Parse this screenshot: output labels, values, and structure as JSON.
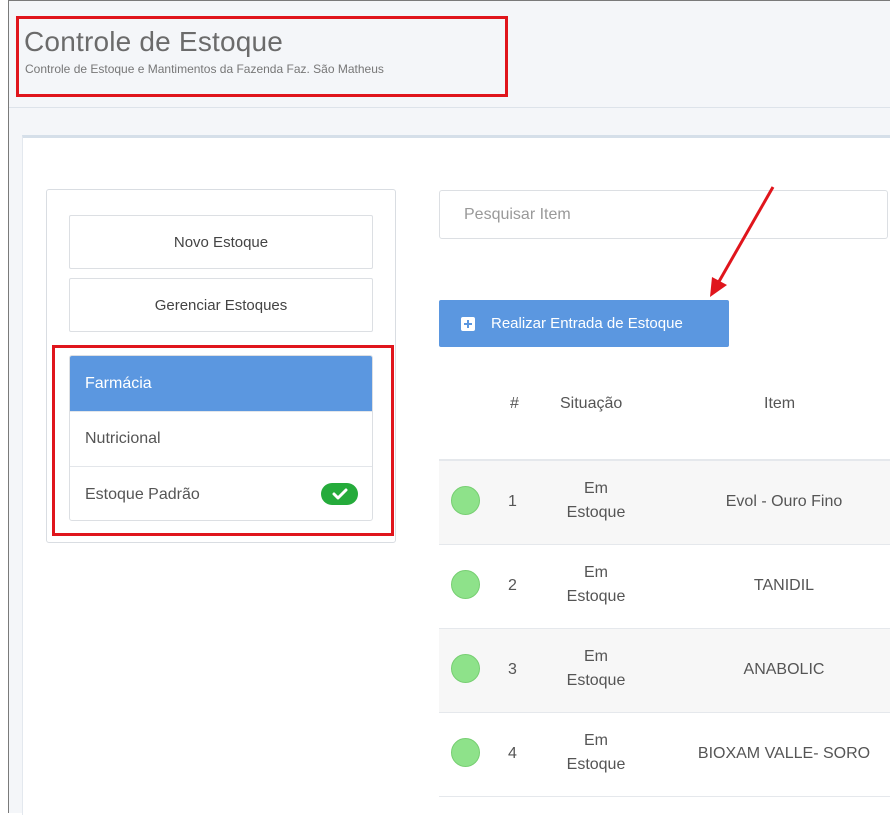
{
  "header": {
    "title": "Controle de Estoque",
    "subtitle": "Controle de Estoque e Mantimentos da Fazenda Faz. São Matheus"
  },
  "sidebar": {
    "new_stock_label": "Novo Estoque",
    "manage_stocks_label": "Gerenciar Estoques",
    "stocks": [
      {
        "label": "Farmácia",
        "active": true
      },
      {
        "label": "Nutricional",
        "active": false
      },
      {
        "label": "Estoque Padrão",
        "active": false,
        "default": true
      }
    ]
  },
  "search": {
    "placeholder": "Pesquisar Item",
    "value": ""
  },
  "actions": {
    "entry_label": "Realizar Entrada de Estoque"
  },
  "table": {
    "headers": [
      "#",
      "Situação",
      "Item"
    ],
    "rows": [
      {
        "num": "1",
        "situacao_line1": "Em",
        "situacao_line2": "Estoque",
        "item": "Evol - Ouro Fino"
      },
      {
        "num": "2",
        "situacao_line1": "Em",
        "situacao_line2": "Estoque",
        "item": "TANIDIL"
      },
      {
        "num": "3",
        "situacao_line1": "Em",
        "situacao_line2": "Estoque",
        "item": "ANABOLIC"
      },
      {
        "num": "4",
        "situacao_line1": "Em",
        "situacao_line2": "Estoque",
        "item": "BIOXAM VALLE- SORO"
      }
    ]
  },
  "icons": {
    "entry": "plus-square-icon",
    "default_stock": "check-icon",
    "status": "status-dot-icon",
    "annotation": "arrow-icon"
  },
  "colors": {
    "primary": "#5b97e0",
    "annotation": "#e0151c",
    "success": "#25ab3b",
    "status_ok": "#8ee28a"
  }
}
